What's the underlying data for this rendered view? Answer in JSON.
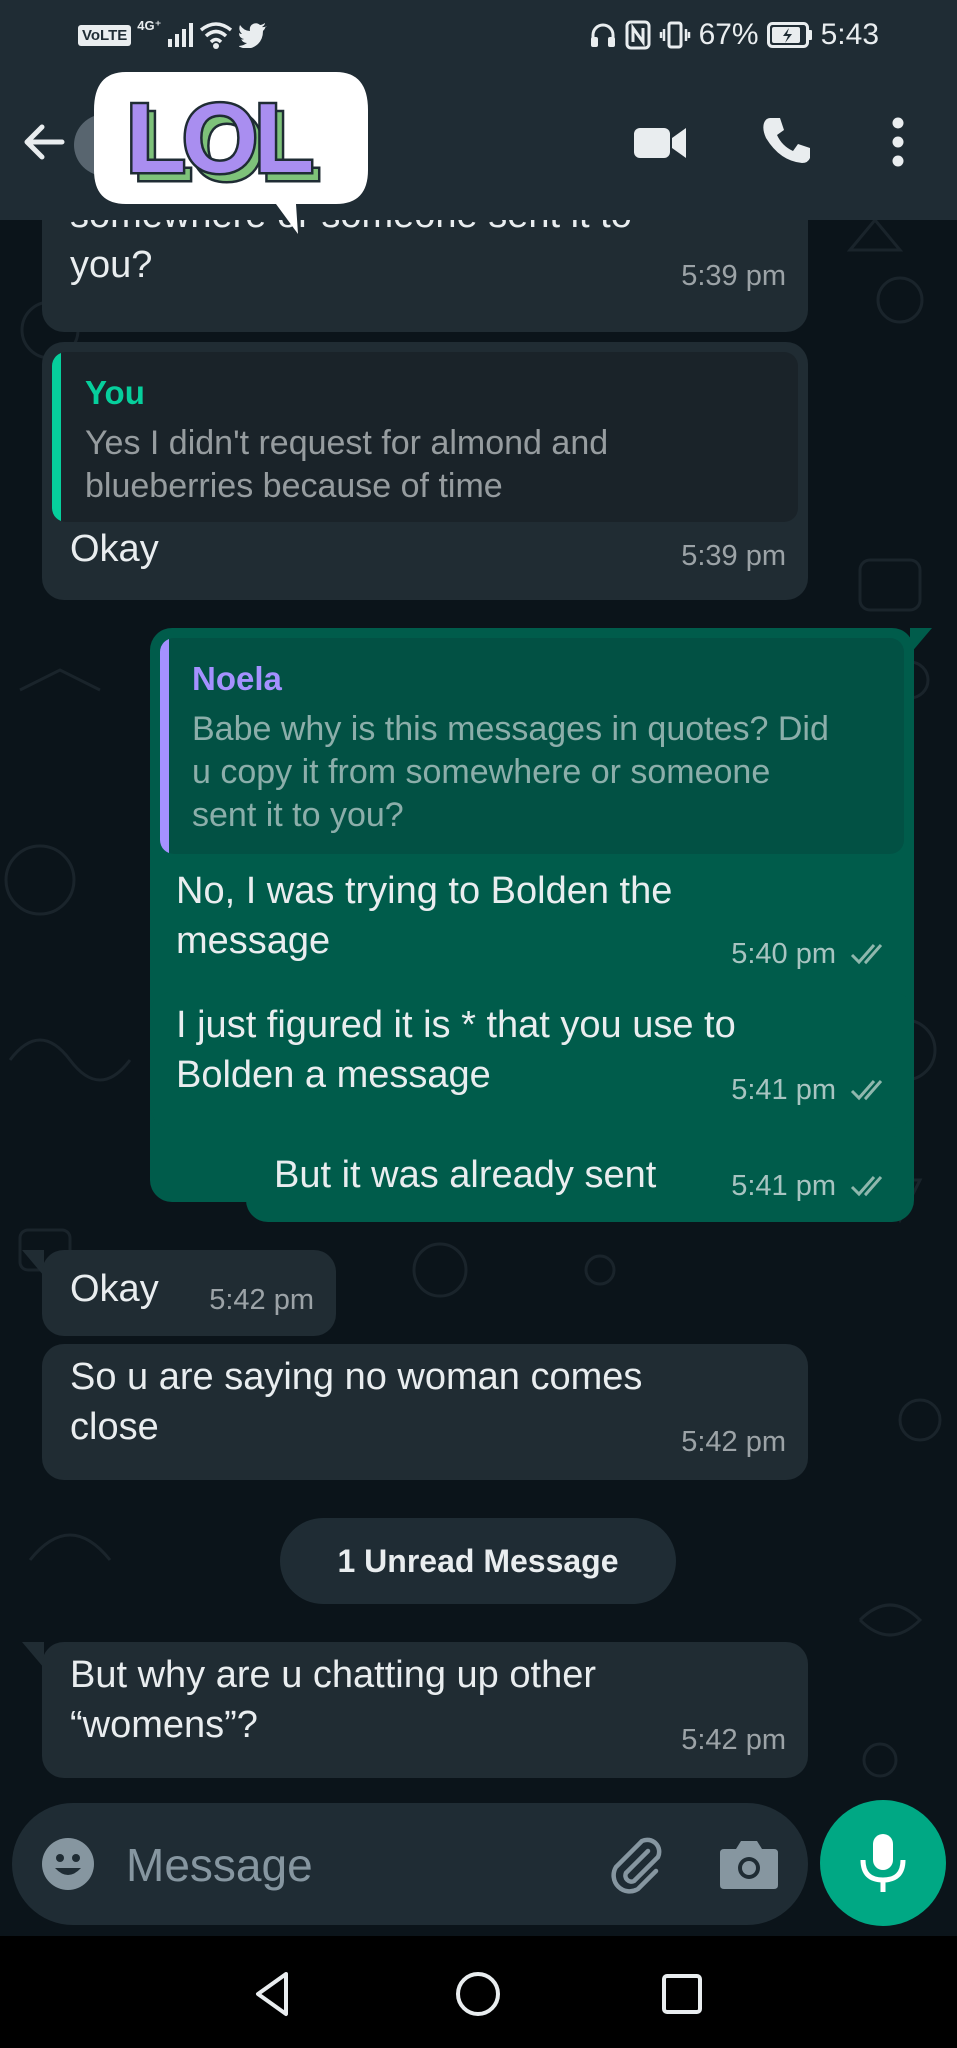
{
  "status_bar": {
    "volte": "VoLTE",
    "network": "4G⁺",
    "battery_percent": "67%",
    "time": "5:43"
  },
  "header": {
    "sticker_text": "LOL",
    "icons": [
      "back-arrow-icon",
      "video-call-icon",
      "voice-call-icon",
      "more-options-icon"
    ]
  },
  "messages": [
    {
      "direction": "in",
      "text": "somewhere or someone sent it to\nyou?",
      "time": "5:39 pm"
    },
    {
      "direction": "in",
      "quote_author": "You",
      "quote_text": "Yes I didn't request for almond and\nblueberries because of time",
      "text": "Okay",
      "time": "5:39 pm"
    },
    {
      "direction": "out",
      "quote_author": "Noela",
      "quote_text": "Babe why is this messages in quotes? Did\nu copy it from somewhere or someone\nsent it to you?",
      "text": "No, I was trying to Bolden the\nmessage",
      "time": "5:40 pm",
      "status": "read"
    },
    {
      "direction": "out",
      "text": "I just figured it is * that you use to\nBolden a message",
      "time": "5:41 pm",
      "status": "read"
    },
    {
      "direction": "out",
      "text": "But it was already sent",
      "time": "5:41 pm",
      "status": "read"
    },
    {
      "direction": "in",
      "text": "Okay",
      "time": "5:42 pm"
    },
    {
      "direction": "in",
      "text": "So u are saying no woman comes\nclose",
      "time": "5:42 pm"
    },
    {
      "direction": "in",
      "text": "But why are u chatting up other\n“womens”?",
      "time": "5:42 pm"
    }
  ],
  "unread_banner": "1 Unread Message",
  "composer": {
    "placeholder": "Message",
    "icons": [
      "emoji-icon",
      "attach-icon",
      "camera-icon",
      "mic-icon"
    ]
  },
  "nav_bar": {
    "icons": [
      "back-triangle-icon",
      "home-circle-icon",
      "recents-square-icon"
    ]
  },
  "colors": {
    "background": "#0b141a",
    "bar": "#1f2c34",
    "incoming": "#202c33",
    "outgoing": "#005c4b",
    "accent": "#00a884",
    "quote_you": "#06cf9c",
    "quote_noela": "#a591ff",
    "read_ticks": "#8fb7ad"
  }
}
